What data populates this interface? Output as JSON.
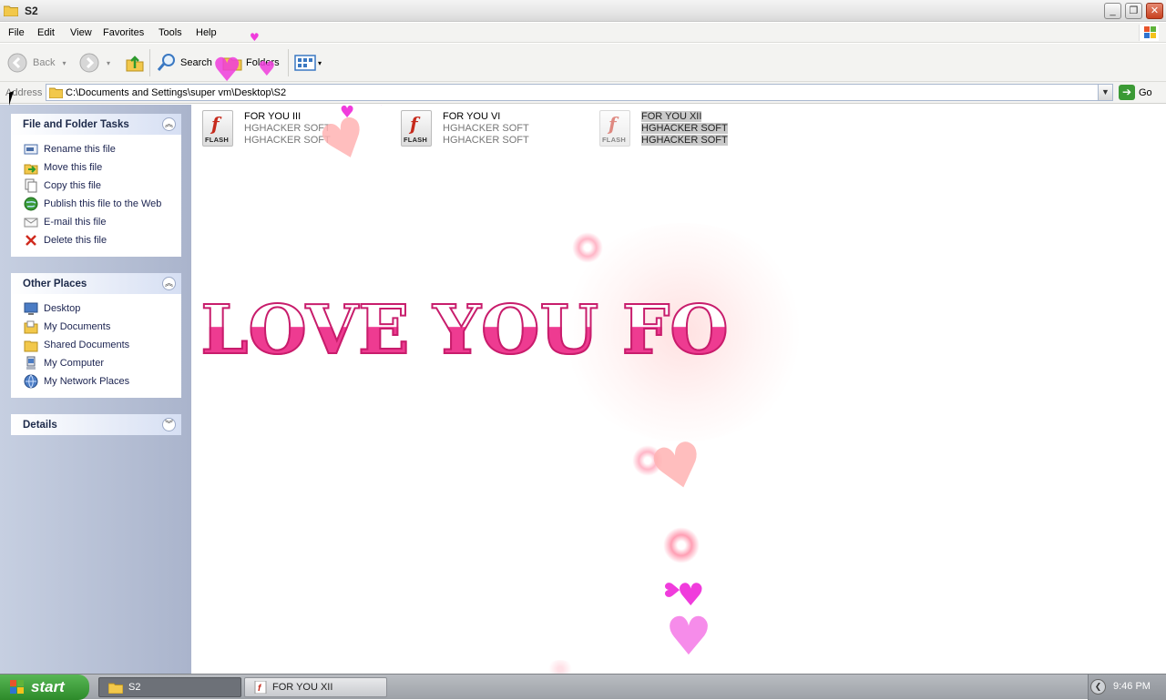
{
  "window": {
    "title": "S2",
    "buttons": {
      "minimize": "_",
      "maximize": "❐",
      "close": "✕"
    }
  },
  "menu": {
    "items": [
      "File",
      "Edit",
      "View",
      "Favorites",
      "Tools",
      "Help"
    ]
  },
  "toolbar": {
    "back_label": "Back",
    "search_label": "Search",
    "folders_label": "Folders"
  },
  "address": {
    "label": "Address",
    "path": "C:\\Documents and Settings\\super vm\\Desktop\\S2",
    "go_label": "Go"
  },
  "sidebar": {
    "tasks": {
      "title": "File and Folder Tasks",
      "items": [
        {
          "label": "Rename this file",
          "icon": "rename-icon"
        },
        {
          "label": "Move this file",
          "icon": "move-icon"
        },
        {
          "label": "Copy this file",
          "icon": "copy-icon"
        },
        {
          "label": "Publish this file to the Web",
          "icon": "publish-web-icon"
        },
        {
          "label": "E-mail this file",
          "icon": "email-icon"
        },
        {
          "label": "Delete this file",
          "icon": "delete-icon"
        }
      ]
    },
    "places": {
      "title": "Other Places",
      "items": [
        {
          "label": "Desktop",
          "icon": "desktop-icon"
        },
        {
          "label": "My Documents",
          "icon": "my-documents-icon"
        },
        {
          "label": "Shared Documents",
          "icon": "shared-folder-icon"
        },
        {
          "label": "My Computer",
          "icon": "my-computer-icon"
        },
        {
          "label": "My Network Places",
          "icon": "network-places-icon"
        }
      ]
    },
    "details": {
      "title": "Details"
    }
  },
  "files": [
    {
      "name": "FOR YOU III",
      "line2": "HGHACKER SOFT",
      "line3": "HGHACKER SOFT",
      "tag": "FLASH",
      "selected": false
    },
    {
      "name": "FOR YOU VI",
      "line2": "HGHACKER SOFT",
      "line3": "HGHACKER SOFT",
      "tag": "FLASH",
      "selected": false
    },
    {
      "name": "FOR YOU XII",
      "line2": "HGHACKER SOFT",
      "line3": "HGHACKER SOFT",
      "tag": "FLASH",
      "selected": true
    }
  ],
  "overlay": {
    "text": "I LOVE YOU FO"
  },
  "taskbar": {
    "start_label": "start",
    "tasks": [
      {
        "label": "S2",
        "active": true
      },
      {
        "label": "FOR YOU XII",
        "active": false
      }
    ],
    "clock": "9:46 PM"
  },
  "colors": {
    "flash_pink": "#ee3b91",
    "heart_magenta": "#f03cdc",
    "heart_peach": "#ffb3b3",
    "sidebar_blue": "#aab4cc",
    "start_green": "#3a9a37"
  }
}
